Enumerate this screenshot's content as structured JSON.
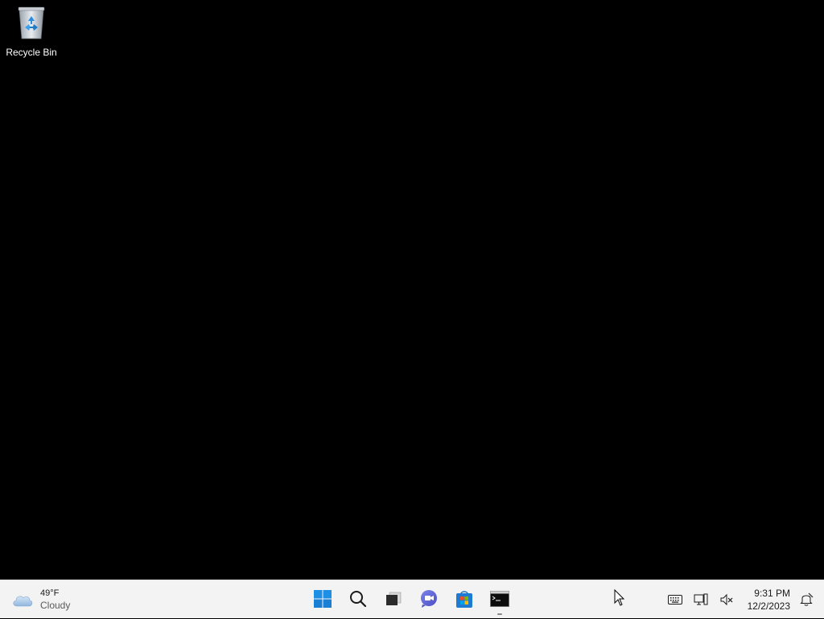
{
  "desktop": {
    "background_color": "#000000",
    "icons": [
      {
        "label": "Recycle Bin",
        "icon": "recycle-bin-icon"
      }
    ]
  },
  "taskbar": {
    "background_color": "#f3f3f3",
    "weather": {
      "temperature": "49°F",
      "condition": "Cloudy",
      "icon": "cloud-icon"
    },
    "pinned": [
      {
        "name": "Start",
        "icon": "windows-start-icon",
        "active": false
      },
      {
        "name": "Search",
        "icon": "search-icon",
        "active": false
      },
      {
        "name": "Task View",
        "icon": "task-view-icon",
        "active": false
      },
      {
        "name": "Chat",
        "icon": "chat-icon",
        "active": false
      },
      {
        "name": "Microsoft Store",
        "icon": "store-icon",
        "active": false
      },
      {
        "name": "Command Prompt",
        "icon": "command-prompt-icon",
        "active": true
      }
    ],
    "tray": {
      "icons": [
        "keyboard-icon",
        "network-icon",
        "volume-muted-icon"
      ],
      "time": "9:31 PM",
      "date": "12/2/2023",
      "notification_icon": "notification-bell-icon"
    }
  }
}
